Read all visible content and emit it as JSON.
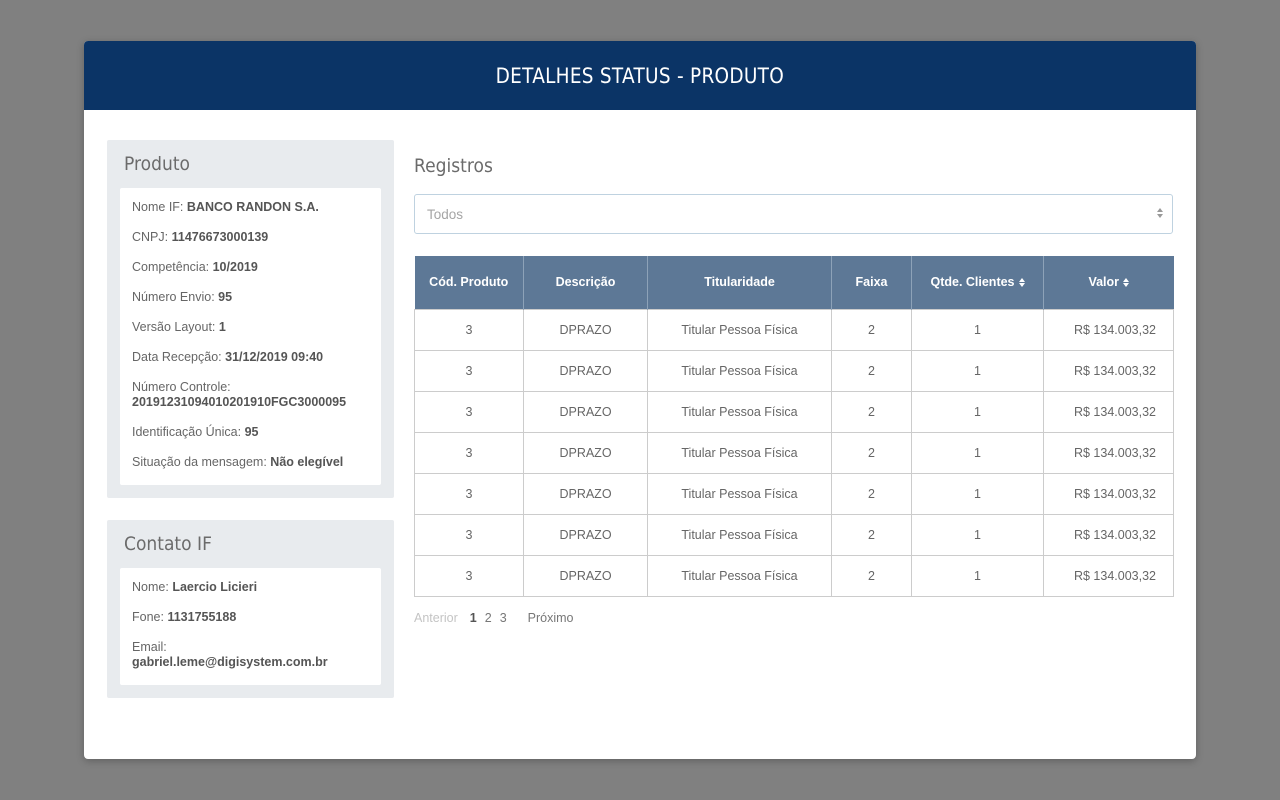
{
  "header": {
    "title": "DETALHES STATUS - PRODUTO"
  },
  "colors": {
    "header_bg": "#0b3466",
    "table_header_bg": "#5d7896",
    "backdrop": "#808080",
    "panel_bg": "#e8ebee"
  },
  "produto": {
    "title": "Produto",
    "fields": [
      {
        "label": "Nome IF:",
        "value": "BANCO RANDON S.A."
      },
      {
        "label": "CNPJ:",
        "value": "11476673000139"
      },
      {
        "label": "Competência:",
        "value": "10/2019"
      },
      {
        "label": "Número Envio:",
        "value": "95"
      },
      {
        "label": "Versão Layout:",
        "value": "1"
      },
      {
        "label": "Data Recepção:",
        "value": "31/12/2019 09:40"
      },
      {
        "label": "Número Controle:",
        "value": "20191231094010201910FGC3000095"
      },
      {
        "label": "Identificação Única:",
        "value": "95"
      },
      {
        "label": "Situação da mensagem:",
        "value": "Não elegível"
      }
    ]
  },
  "contato": {
    "title": "Contato IF",
    "fields": [
      {
        "label": "Nome:",
        "value": "Laercio Licieri"
      },
      {
        "label": "Fone:",
        "value": "1131755188"
      },
      {
        "label": "Email:",
        "value": "gabriel.leme@digisystem.com.br"
      }
    ]
  },
  "registros": {
    "title": "Registros",
    "filter_value": "Todos",
    "columns": [
      "Cód. Produto",
      "Descrição",
      "Titularidade",
      "Faixa",
      "Qtde. Clientes",
      "Valor"
    ],
    "rows": [
      [
        "3",
        "DPRAZO",
        "Titular Pessoa Física",
        "2",
        "1",
        "R$ 134.003,32"
      ],
      [
        "3",
        "DPRAZO",
        "Titular Pessoa Física",
        "2",
        "1",
        "R$ 134.003,32"
      ],
      [
        "3",
        "DPRAZO",
        "Titular Pessoa Física",
        "2",
        "1",
        "R$ 134.003,32"
      ],
      [
        "3",
        "DPRAZO",
        "Titular Pessoa Física",
        "2",
        "1",
        "R$ 134.003,32"
      ],
      [
        "3",
        "DPRAZO",
        "Titular Pessoa Física",
        "2",
        "1",
        "R$ 134.003,32"
      ],
      [
        "3",
        "DPRAZO",
        "Titular Pessoa Física",
        "2",
        "1",
        "R$ 134.003,32"
      ],
      [
        "3",
        "DPRAZO",
        "Titular Pessoa Física",
        "2",
        "1",
        "R$ 134.003,32"
      ]
    ]
  },
  "pagination": {
    "prev_label": "Anterior",
    "pages": [
      "1",
      "2",
      "3"
    ],
    "active_page": "1",
    "next_label": "Próximo"
  }
}
